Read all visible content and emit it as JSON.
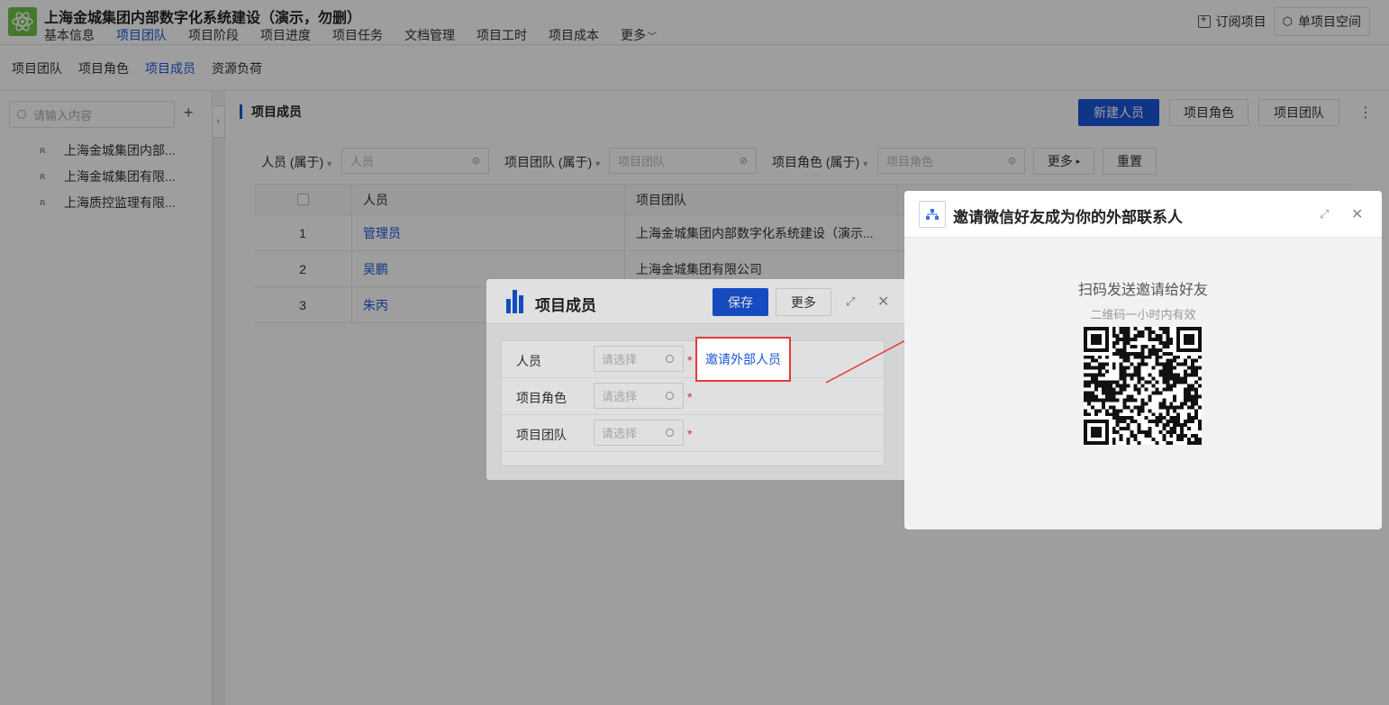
{
  "header": {
    "title": "上海金城集团内部数字化系统建设（演示，勿删）",
    "nav": [
      "基本信息",
      "项目团队",
      "项目阶段",
      "项目进度",
      "项目任务",
      "文档管理",
      "项目工时",
      "项目成本",
      "更多"
    ],
    "active_nav": "项目团队",
    "subscribe_label": "订阅项目",
    "single_space_label": "单项目空间",
    "logo_icon": "atom-icon"
  },
  "subnav": {
    "items": [
      "项目团队",
      "项目角色",
      "项目成员",
      "资源负荷"
    ],
    "active": "项目成员"
  },
  "sidebar": {
    "search_placeholder": "请输入内容",
    "add_label": "+",
    "items": [
      {
        "label": "上海金城集团内部..."
      },
      {
        "label": "上海金城集团有限..."
      },
      {
        "label": "上海质控监理有限..."
      }
    ]
  },
  "main": {
    "section_title": "项目成员",
    "new_person_label": "新建人员",
    "role_btn_label": "项目角色",
    "team_btn_label": "项目团队",
    "filters": {
      "person_label": "人员 (属于)",
      "person_placeholder": "人员",
      "team_label": "项目团队 (属于)",
      "team_placeholder": "项目团队",
      "role_label": "项目角色 (属于)",
      "role_placeholder": "项目角色",
      "more_label": "更多",
      "reset_label": "重置"
    },
    "table": {
      "columns": [
        "人员",
        "项目团队"
      ],
      "rows": [
        {
          "index": "1",
          "person": "管理员",
          "team": "上海金城集团内部数字化系统建设（演示..."
        },
        {
          "index": "2",
          "person": "吴鹏",
          "team": "上海金城集团有限公司"
        },
        {
          "index": "3",
          "person": "朱丙",
          "team": ""
        }
      ]
    }
  },
  "member_dialog": {
    "title": "项目成员",
    "save_label": "保存",
    "more_label": "更多",
    "fields": [
      {
        "label": "人员",
        "placeholder": "请选择"
      },
      {
        "label": "项目角色",
        "placeholder": "请选择"
      },
      {
        "label": "项目团队",
        "placeholder": "请选择"
      }
    ],
    "invite_label": "邀请外部人员",
    "required_mark": "*"
  },
  "wechat_dialog": {
    "title": "邀请微信好友成为你的外部联系人",
    "scan_text": "扫码发送邀请给好友",
    "valid_text": "二维码一小时内有效"
  },
  "colors": {
    "accent": "#1a56db",
    "highlight": "#e53935",
    "logo": "#6cc24a"
  }
}
